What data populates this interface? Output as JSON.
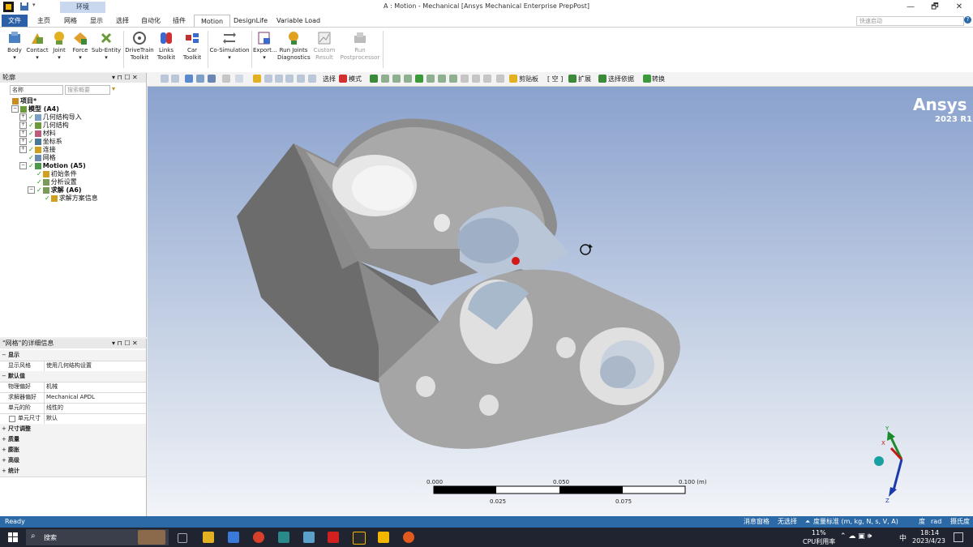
{
  "window": {
    "title": "A : Motion - Mechanical [Ansys Mechanical Enterprise PrepPost]",
    "env_tag": "环境",
    "controls": [
      "—",
      "🗗",
      "✕"
    ]
  },
  "menubar": {
    "items": [
      "文件",
      "主页",
      "网格",
      "显示",
      "选择",
      "自动化",
      "插件",
      "Motion",
      "DesignLife",
      "Variable Load"
    ],
    "active_index": 7,
    "search_placeholder": "快速启动"
  },
  "ribbon": {
    "buttons": [
      {
        "label1": "Body",
        "label2": "",
        "icon": "body-icon",
        "color": "#4a7fc1"
      },
      {
        "label1": "Contact",
        "label2": "",
        "icon": "contact-icon",
        "color": "#d4a020"
      },
      {
        "label1": "Joint",
        "label2": "",
        "icon": "joint-icon",
        "color": "#e2b020"
      },
      {
        "label1": "Force",
        "label2": "",
        "icon": "force-icon",
        "color": "#e0a030"
      },
      {
        "label1": "Sub-Entity",
        "label2": "",
        "icon": "subentity-icon",
        "color": "#6a9a3a"
      },
      {
        "label1": "DriveTrain",
        "label2": "Toolkit",
        "icon": "drivetrain-icon",
        "color": "#555555"
      },
      {
        "label1": "Links",
        "label2": "Toolkit",
        "icon": "links-icon",
        "color": "#d03030"
      },
      {
        "label1": "Car",
        "label2": "Toolkit",
        "icon": "car-icon",
        "color": "#c03030"
      },
      {
        "label1": "Co-Simulation",
        "label2": "",
        "icon": "cosimulation-icon",
        "color": "#666666"
      },
      {
        "label1": "Export...",
        "label2": "",
        "icon": "export-icon",
        "color": "#7a3a6a"
      },
      {
        "label1": "Run Joints",
        "label2": "Diagnostics",
        "icon": "run-joints-icon",
        "color": "#e0a020"
      },
      {
        "label1": "Custom",
        "label2": "Result",
        "icon": "custom-result-icon",
        "color": "#999999",
        "disabled": true
      },
      {
        "label1": "Run",
        "label2": "Postprocessor",
        "icon": "run-postprocessor-icon",
        "color": "#999999",
        "disabled": true
      }
    ]
  },
  "toolbar": {
    "select_label": "选择",
    "mode_label": "模式",
    "clipboard_label": "剪贴板",
    "empty_label": "[ 空 ]",
    "expand_label": "扩展",
    "select_by_label": "选择依据",
    "convert_label": "转换"
  },
  "outline": {
    "title": "轮廓",
    "filter_name": "名称",
    "filter_search_placeholder": "搜索概要",
    "nodes": [
      {
        "label": "项目*",
        "indent": 0,
        "expander": "",
        "check": false,
        "bold": true,
        "color": "#c98a20"
      },
      {
        "label": "模型 (A4)",
        "indent": 1,
        "expander": "−",
        "check": false,
        "bold": true,
        "color": "#6a9a3a"
      },
      {
        "label": "几何结构导入",
        "indent": 2,
        "expander": "+",
        "check": true,
        "bold": false,
        "color": "#7aa0c8"
      },
      {
        "label": "几何结构",
        "indent": 2,
        "expander": "+",
        "check": true,
        "bold": false,
        "color": "#6a9a3a"
      },
      {
        "label": "材料",
        "indent": 2,
        "expander": "+",
        "check": true,
        "bold": false,
        "color": "#c05a7a"
      },
      {
        "label": "坐标系",
        "indent": 2,
        "expander": "+",
        "check": true,
        "bold": false,
        "color": "#4a7a9a"
      },
      {
        "label": "连接",
        "indent": 2,
        "expander": "+",
        "check": true,
        "bold": false,
        "color": "#d0a020"
      },
      {
        "label": "网格",
        "indent": 2,
        "expander": "",
        "check": true,
        "bold": false,
        "color": "#6a8ab0"
      },
      {
        "label": "Motion (A5)",
        "indent": 2,
        "expander": "−",
        "check": true,
        "bold": true,
        "color": "#4a9a4a"
      },
      {
        "label": "初始条件",
        "indent": 3,
        "expander": "",
        "check": true,
        "bold": false,
        "color": "#d0a020"
      },
      {
        "label": "分析设置",
        "indent": 3,
        "expander": "",
        "check": true,
        "bold": false,
        "color": "#7a9a5a"
      },
      {
        "label": "求解 (A6)",
        "indent": 3,
        "expander": "−",
        "check": true,
        "bold": true,
        "color": "#7a9a5a"
      },
      {
        "label": "求解方案信息",
        "indent": 4,
        "expander": "",
        "check": true,
        "bold": false,
        "color": "#d0a020"
      }
    ]
  },
  "details": {
    "title": "\"网格\"的详细信息",
    "rows": [
      {
        "type": "group",
        "label": "显示",
        "pm": "−"
      },
      {
        "type": "prop",
        "name": "显示风格",
        "value": "使用几何结构设置"
      },
      {
        "type": "group",
        "label": "默认值",
        "pm": "−"
      },
      {
        "type": "prop",
        "name": "物理偏好",
        "value": "机械"
      },
      {
        "type": "prop",
        "name": "求解器偏好",
        "value": "Mechanical APDL"
      },
      {
        "type": "prop",
        "name": "单元的阶",
        "value": "线性的"
      },
      {
        "type": "prop",
        "name": "单元尺寸",
        "value": "默认",
        "checkbox": true
      },
      {
        "type": "group",
        "label": "尺寸调整",
        "pm": "+"
      },
      {
        "type": "group",
        "label": "质量",
        "pm": "+"
      },
      {
        "type": "group",
        "label": "膨胀",
        "pm": "+"
      },
      {
        "type": "group",
        "label": "高级",
        "pm": "+"
      },
      {
        "type": "group",
        "label": "统计",
        "pm": "+"
      }
    ]
  },
  "viewport": {
    "brand": "Ansys",
    "version": "2023 R1",
    "scale_ticks_top": [
      "0.000",
      "0.050",
      "0.100 (m)"
    ],
    "scale_ticks_bottom": [
      "0.025",
      "0.075"
    ],
    "triad": {
      "y": "Y",
      "x": "X",
      "z": "Z"
    }
  },
  "statusbar": {
    "ready": "Ready",
    "messages": "消息窗格",
    "selection": "无选择",
    "units": "度量标准 (m, kg, N, s, V, A)",
    "angle": "度",
    "rad": "rad",
    "temp": "摄氏度"
  },
  "taskbar": {
    "search": "搜索",
    "cpu_percent": "11%",
    "cpu_label": "CPU利用率",
    "ime": "中",
    "time": "18:14",
    "date": "2023/4/23"
  }
}
